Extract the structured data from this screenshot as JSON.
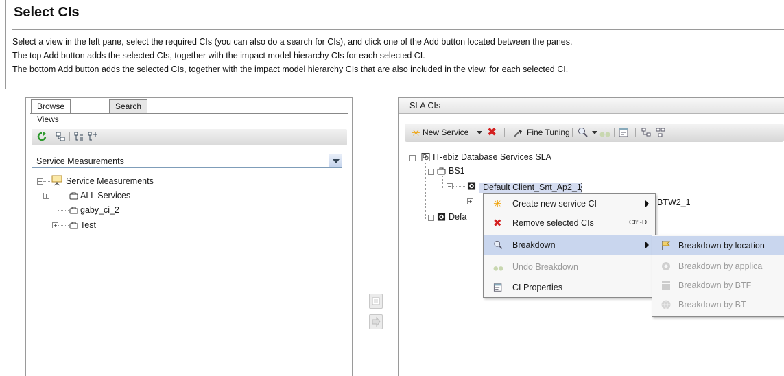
{
  "page": {
    "title": "Select CIs",
    "instructions": [
      "Select a view in the left pane, select the required CIs (you can also do a search for CIs), and click one of the Add button located between the panes.",
      "The top Add button adds the selected CIs, together with the impact model hierarchy CIs for each selected CI.",
      "The bottom Add button adds the selected CIs, together with the impact model hierarchy CIs that are also included in the view, for each selected CI."
    ]
  },
  "left_pane": {
    "tabs": [
      {
        "label": "Browse Views",
        "active": true
      },
      {
        "label": "Search",
        "active": false
      }
    ],
    "toolbar_icons": [
      "refresh-icon",
      "hierarchy-icon",
      "expand-all-icon",
      "collapse-all-icon"
    ],
    "view_select": {
      "value": "Service Measurements"
    },
    "tree": {
      "root": "Service Measurements",
      "children": [
        {
          "label": "ALL Services",
          "expandable": true
        },
        {
          "label": "gaby_ci_2",
          "expandable": false
        },
        {
          "label": "Test",
          "expandable": true
        }
      ]
    }
  },
  "right_pane": {
    "header": "SLA CIs",
    "toolbar": {
      "new_service": "New Service",
      "fine_tuning": "Fine Tuning"
    },
    "tree": {
      "root": "IT-ebiz Database Services SLA",
      "bs1": "BS1",
      "selected": "Default Client_Snt_Ap2_1",
      "hidden_child_suffix": "BTW2_1",
      "second": "Defa"
    }
  },
  "context_menu": {
    "items": [
      {
        "label": "Create new service CI",
        "icon": "asterisk-icon",
        "submenu": true,
        "disabled": false
      },
      {
        "label": "Remove selected CIs",
        "icon": "red-x-icon",
        "shortcut": "Ctrl-D",
        "disabled": false
      },
      {
        "label": "Breakdown",
        "icon": "magnifier-icon",
        "submenu": true,
        "disabled": false,
        "highlighted": true
      },
      {
        "label": "Undo Breakdown",
        "icon": "binoculars-icon",
        "disabled": true
      },
      {
        "label": "CI Properties",
        "icon": "properties-icon",
        "disabled": false
      }
    ]
  },
  "breakdown_submenu": {
    "items": [
      {
        "label": "Breakdown by location",
        "icon": "flag-icon",
        "disabled": false,
        "highlighted": true
      },
      {
        "label": "Breakdown by applica",
        "icon": "gear-icon",
        "disabled": true
      },
      {
        "label": "Breakdown by BTF",
        "icon": "server-icon",
        "disabled": true
      },
      {
        "label": "Breakdown by BT",
        "icon": "globe-icon",
        "disabled": true
      }
    ]
  },
  "colors": {
    "menu_highlight": "#c9d6ee",
    "selection": "#d4dcf0",
    "remove_red": "#d42020",
    "asterisk_orange": "#f0a000"
  }
}
